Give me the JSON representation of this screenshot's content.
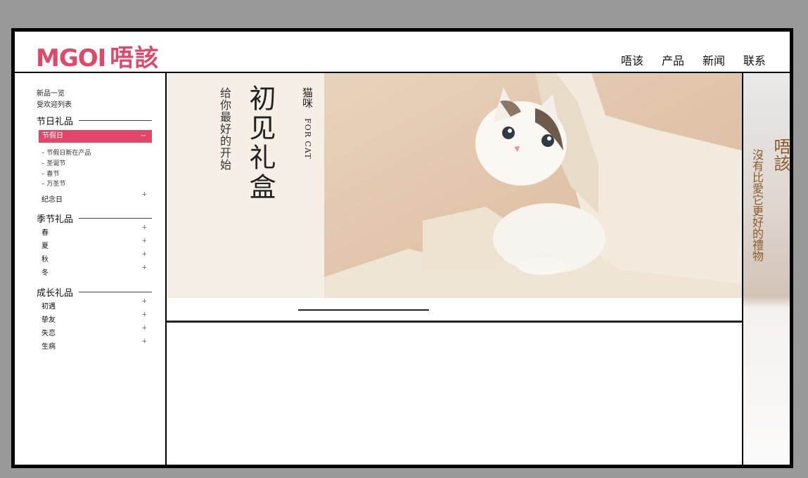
{
  "header": {
    "logo_en": "MGOI",
    "logo_cn": "唔該",
    "nav": [
      "唔该",
      "产品",
      "新闻",
      "联系"
    ]
  },
  "sidebar": {
    "top_links": [
      "新品一览",
      "受欢迎列表"
    ],
    "sections": [
      {
        "title": "节日礼品",
        "active_item": {
          "label": "节假日",
          "toggle": "−"
        },
        "subitems": [
          "节假日新在产品",
          "圣诞节",
          "春节",
          "万圣节"
        ],
        "items": [
          {
            "label": "纪念日",
            "toggle": "+"
          }
        ]
      },
      {
        "title": "季节礼品",
        "items": [
          {
            "label": "春",
            "toggle": "+"
          },
          {
            "label": "夏",
            "toggle": "+"
          },
          {
            "label": "秋",
            "toggle": "+"
          },
          {
            "label": "冬",
            "toggle": "+"
          }
        ]
      },
      {
        "title": "成长礼品",
        "items": [
          {
            "label": "初遇",
            "toggle": "+"
          },
          {
            "label": "挚友",
            "toggle": "+"
          },
          {
            "label": "失恋",
            "toggle": "+"
          },
          {
            "label": "生病",
            "toggle": "+"
          }
        ]
      }
    ]
  },
  "banner": {
    "title": "初见礼盒",
    "subtitle": "给你最好的开始",
    "tag_cn": "猫咪",
    "tag_en": "FOR CAT"
  },
  "right_panel": {
    "brand": "唔該",
    "slogan": "沒有比愛它更好的禮物"
  },
  "colors": {
    "brand": "#e2476a",
    "accent_brown": "#8b5a2b"
  }
}
